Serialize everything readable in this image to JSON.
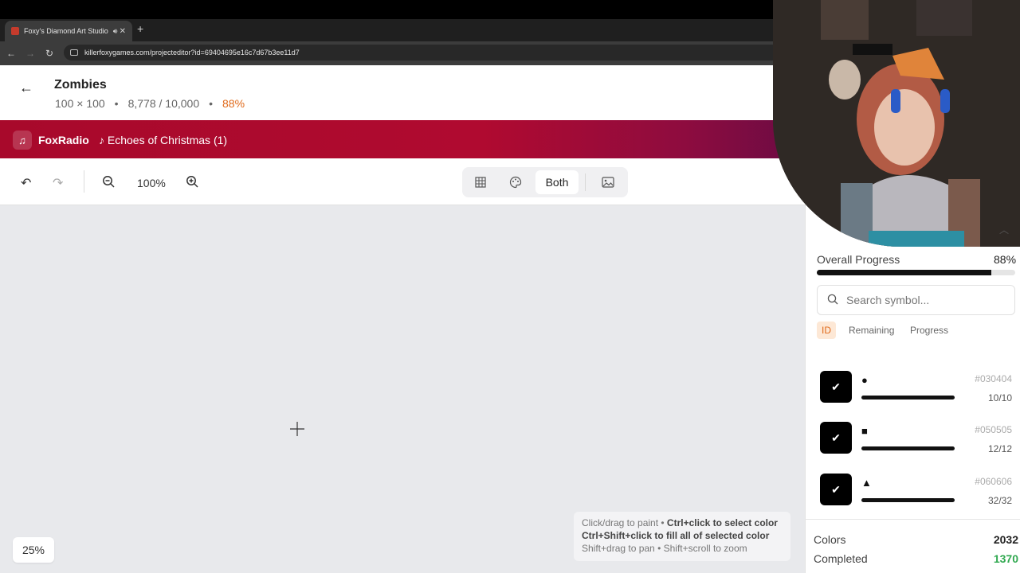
{
  "browser": {
    "tab_title": "Foxy's Diamond Art Studio",
    "url": "killerfoxygames.com/projecteditor?id=69404695e16c7d67b3ee11d7"
  },
  "project": {
    "title": "Zombies",
    "dimensions": "100 × 100",
    "placed": "8,778 / 10,000",
    "percent": "88%"
  },
  "radio": {
    "name": "FoxRadio",
    "song": "♪ Echoes of Christmas (1)"
  },
  "toolbar": {
    "zoom": "100%",
    "view_mode": "Both"
  },
  "canvas": {
    "zoom_badge": "25%",
    "hint_line1_plain": "Click/drag to paint • ",
    "hint_line1_bold": "Ctrl+click to select color",
    "hint_line2_bold": "Ctrl+Shift+click to fill all of selected color",
    "hint_line3": "Shift+drag to pan • Shift+scroll to zoom"
  },
  "sidebar": {
    "overall_label": "Overall Progress",
    "overall_value": "88%",
    "overall_fraction": 0.88,
    "search_placeholder": "Search symbol...",
    "sort_tabs": [
      "ID",
      "Remaining",
      "Progress"
    ],
    "items": [
      {
        "symbol": "●",
        "hex": "#030404",
        "count": "10/10"
      },
      {
        "symbol": "■",
        "hex": "#050505",
        "count": "12/12"
      },
      {
        "symbol": "▲",
        "hex": "#060606",
        "count": "32/32"
      }
    ],
    "stats": {
      "colors_label": "Colors",
      "colors_value": "2032",
      "completed_label": "Completed",
      "completed_value": "1370"
    }
  }
}
